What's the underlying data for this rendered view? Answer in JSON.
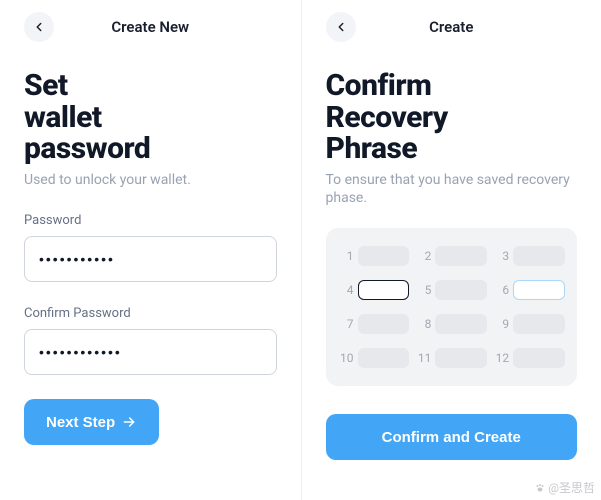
{
  "left": {
    "header_title": "Create New",
    "title_lines": [
      "Set",
      "wallet",
      "password"
    ],
    "subtitle": "Used to unlock your wallet.",
    "password_label": "Password",
    "password_value": "•••••••••••",
    "confirm_label": "Confirm Password",
    "confirm_value": "••••••••••••",
    "next_button": "Next Step"
  },
  "right": {
    "header_title": "Create",
    "title_lines": [
      "Confirm",
      "Recovery",
      "Phrase"
    ],
    "subtitle": "To ensure that you have saved recovery phase.",
    "slots": [
      {
        "n": "1",
        "state": "empty"
      },
      {
        "n": "2",
        "state": "empty"
      },
      {
        "n": "3",
        "state": "empty"
      },
      {
        "n": "4",
        "state": "active"
      },
      {
        "n": "5",
        "state": "empty"
      },
      {
        "n": "6",
        "state": "highlight"
      },
      {
        "n": "7",
        "state": "empty"
      },
      {
        "n": "8",
        "state": "empty"
      },
      {
        "n": "9",
        "state": "empty"
      },
      {
        "n": "10",
        "state": "empty"
      },
      {
        "n": "11",
        "state": "empty"
      },
      {
        "n": "12",
        "state": "empty"
      }
    ],
    "confirm_button": "Confirm and Create"
  },
  "watermark": "@圣思哲"
}
